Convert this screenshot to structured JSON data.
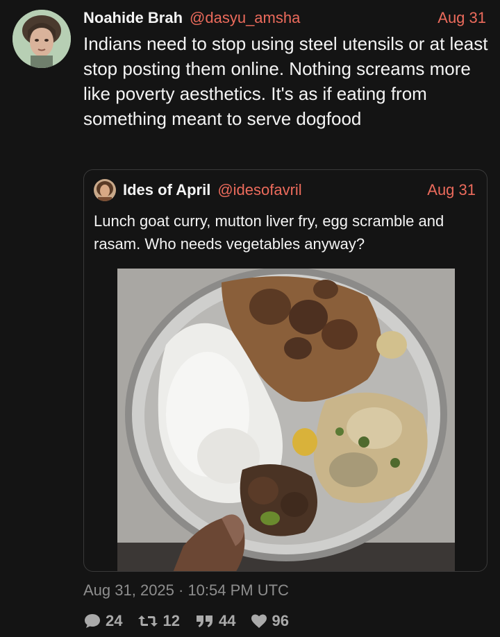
{
  "tweet": {
    "display_name": "Noahide Brah",
    "handle": "@dasyu_amsha",
    "date": "Aug 31",
    "text": "Indians need to stop using steel utensils or at least stop posting them online. Nothing screams more like poverty aesthetics. It's as if eating from something meant to serve dogfood",
    "timestamp": "Aug 31, 2025 · 10:54 PM UTC",
    "stats": {
      "replies": "24",
      "retweets": "12",
      "quotes": "44",
      "likes": "96"
    }
  },
  "quoted_tweet": {
    "display_name": "Ides of April",
    "handle": "@idesofavril",
    "date": "Aug 31",
    "text": "Lunch goat curry, mutton liver fry, egg scramble and rasam. Who needs vegetables anyway?"
  },
  "icons": {
    "reply": "speech-bubble-icon",
    "retweet": "retweet-icon",
    "quote": "quote-icon",
    "like": "heart-icon"
  },
  "colors": {
    "background": "#141414",
    "accent": "#ec6b5c",
    "muted": "#8e8e8e"
  }
}
